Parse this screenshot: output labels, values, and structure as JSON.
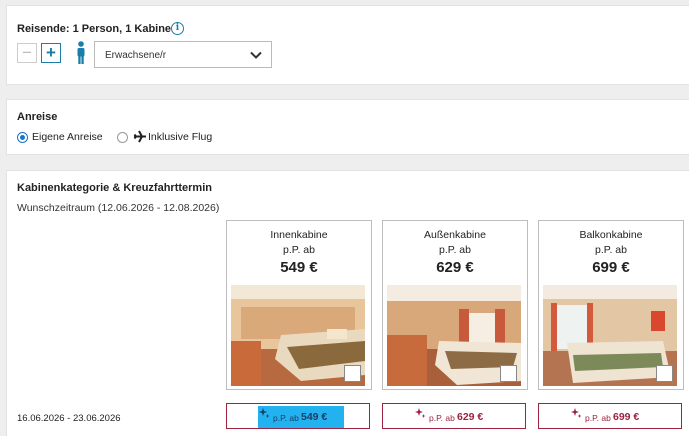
{
  "travellers": {
    "title": "Reisende: 1 Person, 1 Kabine",
    "minus": "−",
    "plus": "+",
    "type_select": "Erwachsene/r"
  },
  "arrival": {
    "title": "Anreise",
    "options": [
      {
        "label": "Eigene Anreise",
        "selected": true
      },
      {
        "label": "Inklusive Flug",
        "selected": false
      }
    ]
  },
  "cabins": {
    "title": "Kabinenkategorie & Kreuzfahrttermin",
    "period": "Wunschzeitraum (12.06.2026 - 12.08.2026)",
    "categories": [
      {
        "name": "Innenkabine",
        "pp": "p.P. ab",
        "price": "549 €"
      },
      {
        "name": "Außenkabine",
        "pp": "p.P. ab",
        "price": "629 €"
      },
      {
        "name": "Balkonkabine",
        "pp": "p.P. ab",
        "price": "699 €"
      }
    ],
    "dates": [
      {
        "label": "16.06.2026 - 23.06.2026",
        "prices": [
          {
            "pp": "p.P. ab",
            "amount": "549 €"
          },
          {
            "pp": "p.P. ab",
            "amount": "629 €"
          },
          {
            "pp": "p.P. ab",
            "amount": "699 €"
          }
        ]
      }
    ]
  },
  "colors": {
    "accent": "#1a7ea8",
    "price": "#9c2240",
    "highlight": "#22b2f0"
  }
}
